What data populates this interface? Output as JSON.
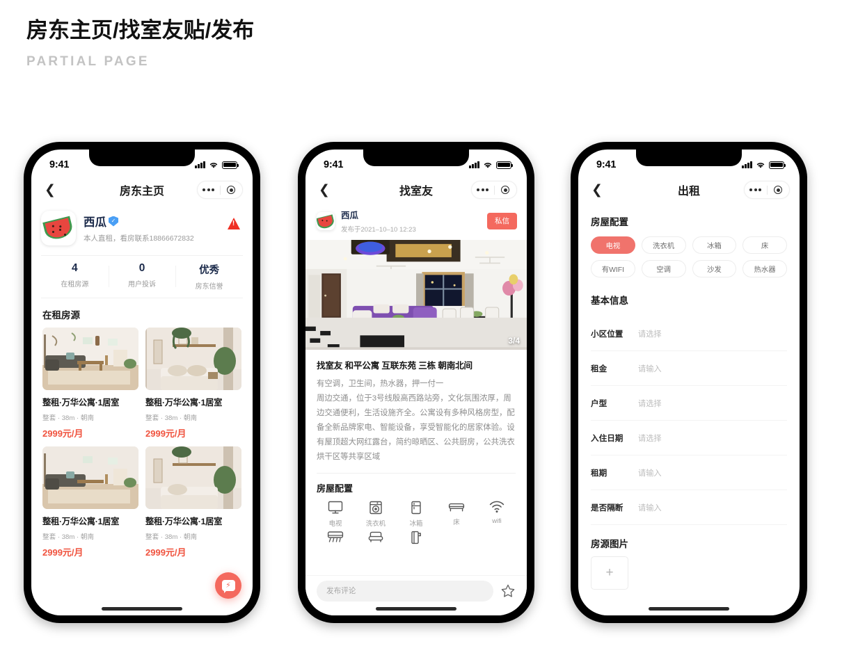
{
  "header": {
    "title": "房东主页/找室友贴/发布",
    "subtitle": "PARTIAL PAGE",
    "highlight_color": "#f0a080"
  },
  "accent_colors": {
    "primary": "#f4695e",
    "chip_selected": "#f0736c",
    "price": "#f0533f",
    "warning": "#ef2f24",
    "verified": "#4a9ff5"
  },
  "status_bar": {
    "time": "9:41",
    "signal_icon": "signal-bars-icon",
    "wifi_icon": "wifi-icon",
    "battery_icon": "battery-icon"
  },
  "capsule": {
    "more_icon": "more-dots-icon",
    "target_icon": "target-circle-icon"
  },
  "phone1": {
    "nav": {
      "back_icon": "chevron-left-icon",
      "title": "房东主页"
    },
    "host": {
      "avatar_icon": "watermelon-avatar",
      "name": "西瓜",
      "verified_icon": "verified-shield-icon",
      "description": "本人直租，看房联系18866672832",
      "report_icon": "warning-triangle-icon"
    },
    "stats": [
      {
        "value": "4",
        "label": "在租房源"
      },
      {
        "value": "0",
        "label": "用户投诉"
      },
      {
        "value": "优秀",
        "label": "房东信誉"
      }
    ],
    "section_title": "在租房源",
    "listings": [
      {
        "thumb": "living-room-photo",
        "title": "整租·万华公寓·1居室",
        "meta": "整套 · 38m · 朝南",
        "price": "2999元/月"
      },
      {
        "thumb": "bedroom-photo",
        "title": "整租·万华公寓·1居室",
        "meta": "整套 · 38m · 朝南",
        "price": "2999元/月"
      },
      {
        "thumb": "living-room-photo",
        "title": "整租·万华公寓·1居室",
        "meta": "整套 · 38m · 朝南",
        "price": "2999元/月"
      },
      {
        "thumb": "bedroom-photo",
        "title": "整租·万华公寓·1居室",
        "meta": "整套 · 38m · 朝南",
        "price": "2999元/月"
      }
    ],
    "fab": {
      "icon": "chat-bolt-icon",
      "bolt": "⚡"
    }
  },
  "phone2": {
    "nav": {
      "back_icon": "chevron-left-icon",
      "title": "找室友"
    },
    "poster": {
      "avatar_icon": "watermelon-avatar",
      "name": "西瓜",
      "date": "发布于2021–10–10 12:23",
      "message_button": "私信"
    },
    "photo": {
      "image_name": "apartment-living-room-photo",
      "pager": "3/4"
    },
    "post": {
      "title": "找室友 和平公寓 互联东苑 三栋 朝南北间",
      "body": "有空调，卫生间，热水器，押一付一\n周边交通，位于3号线殷高西路站旁，文化氛围浓厚，周边交通便利，生活设施齐全。公寓设有多种风格房型，配备全新品牌家电、智能设备，享受智能化的居家体验。设有屋顶超大网红露台，简约晾晒区、公共厨房，公共洗衣烘干区等共享区域"
    },
    "config_title": "房屋配置",
    "amenities": [
      {
        "icon": "tv-icon",
        "label": "电视"
      },
      {
        "icon": "washing-machine-icon",
        "label": "洗衣机"
      },
      {
        "icon": "refrigerator-icon",
        "label": "冰箱"
      },
      {
        "icon": "bed-icon",
        "label": "床"
      },
      {
        "icon": "wifi-icon",
        "label": "wifi"
      },
      {
        "icon": "air-conditioner-icon",
        "label": ""
      },
      {
        "icon": "sofa-icon",
        "label": ""
      },
      {
        "icon": "water-heater-icon",
        "label": ""
      }
    ],
    "comment": {
      "placeholder": "发布评论",
      "value": "",
      "favorite_icon": "star-outline-icon"
    }
  },
  "phone3": {
    "nav": {
      "back_icon": "chevron-left-icon",
      "title": "出租"
    },
    "config_title": "房屋配置",
    "chips": [
      {
        "label": "电视",
        "selected": true
      },
      {
        "label": "洗衣机",
        "selected": false
      },
      {
        "label": "冰箱",
        "selected": false
      },
      {
        "label": "床",
        "selected": false
      },
      {
        "label": "有WIFI",
        "selected": false
      },
      {
        "label": "空调",
        "selected": false
      },
      {
        "label": "沙发",
        "selected": false
      },
      {
        "label": "热水器",
        "selected": false
      }
    ],
    "basic_title": "基本信息",
    "fields": [
      {
        "label": "小区位置",
        "placeholder": "请选择"
      },
      {
        "label": "租金",
        "placeholder": "请输入"
      },
      {
        "label": "户型",
        "placeholder": "请选择"
      },
      {
        "label": "入住日期",
        "placeholder": "请选择"
      },
      {
        "label": "租期",
        "placeholder": "请输入"
      },
      {
        "label": "是否隔断",
        "placeholder": "请输入"
      }
    ],
    "images_title": "房源图片",
    "upload": {
      "icon": "plus-icon",
      "label": "+"
    }
  }
}
